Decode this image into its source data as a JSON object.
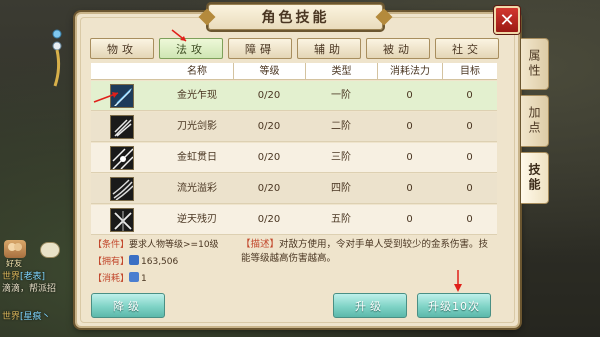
{
  "window": {
    "title": "角色技能",
    "close_icon": "close-icon"
  },
  "tabs": [
    {
      "label": "物攻",
      "active": false
    },
    {
      "label": "法攻",
      "active": true
    },
    {
      "label": "障碍",
      "active": false
    },
    {
      "label": "辅助",
      "active": false
    },
    {
      "label": "被动",
      "active": false
    },
    {
      "label": "社交",
      "active": false
    }
  ],
  "side_tabs": [
    {
      "label": "属性",
      "active": false
    },
    {
      "label": "加点",
      "active": false
    },
    {
      "label": "技能",
      "active": true
    }
  ],
  "table": {
    "headers": [
      "名称",
      "等级",
      "类型",
      "消耗法力",
      "目标"
    ],
    "rows": [
      {
        "name": "金光乍现",
        "level": "0/20",
        "type": "一阶",
        "mana": "0",
        "target": "0",
        "selected": true
      },
      {
        "name": "刀光剑影",
        "level": "0/20",
        "type": "二阶",
        "mana": "0",
        "target": "0",
        "selected": false
      },
      {
        "name": "金虹贯日",
        "level": "0/20",
        "type": "三阶",
        "mana": "0",
        "target": "0",
        "selected": false
      },
      {
        "name": "流光溢彩",
        "level": "0/20",
        "type": "四阶",
        "mana": "0",
        "target": "0",
        "selected": false
      },
      {
        "name": "逆天残刃",
        "level": "0/20",
        "type": "五阶",
        "mana": "0",
        "target": "0",
        "selected": false
      }
    ]
  },
  "info": {
    "condition_label": "【条件】",
    "condition_text": "要求人物等级>=10级",
    "owned_label": "【拥有】",
    "owned_value": "163,506",
    "cost_label": "【消耗】",
    "cost_value": "1",
    "desc_label": "【描述】",
    "desc_text": "对敌方使用，令对手单人受到较少的金系伤害。技能等级越高伤害越高。"
  },
  "buttons": {
    "downgrade": "降级",
    "upgrade": "升级",
    "upgrade10": "升级10次"
  },
  "chat": {
    "lines": [
      {
        "tag": "世界",
        "name": "[老表]",
        "text": ""
      },
      {
        "tag": "",
        "name": "",
        "text": "滴滴，帮派招"
      },
      {
        "tag": "世界",
        "name": "[星痕丶",
        "text": ""
      }
    ],
    "badge": "好友"
  },
  "colors": {
    "accent_green": "#cfe6b4",
    "button_teal": "#7fd3c6",
    "close_red": "#c8302a",
    "annotation_red": "#e0201a"
  }
}
